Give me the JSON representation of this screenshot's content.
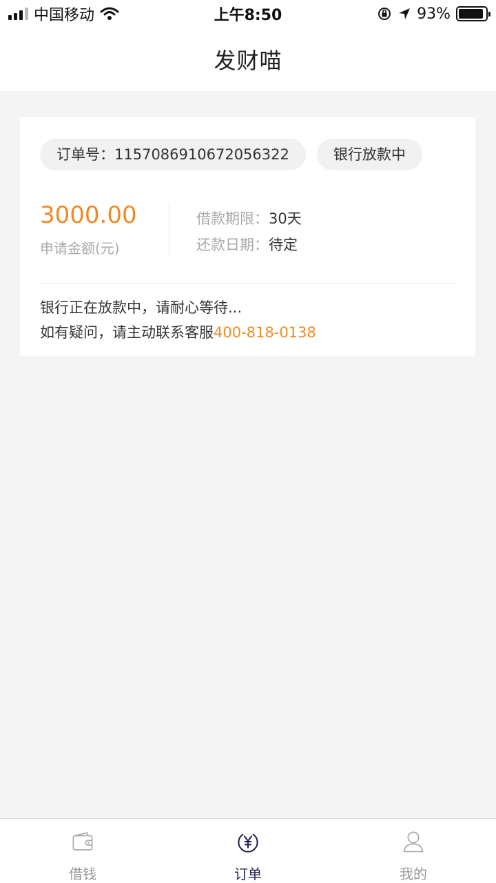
{
  "status_bar": {
    "carrier": "中国移动",
    "time": "上午8:50",
    "battery": "93%",
    "battery_level": 0.93
  },
  "nav": {
    "title": "发财喵"
  },
  "order": {
    "order_no_label": "订单号：",
    "order_no": "1157086910672056322",
    "status": "银行放款中",
    "amount": "3000.00",
    "amount_label": "申请金额(元)",
    "term_label": "借款期限：",
    "term_value": "30天",
    "repay_label": "还款日期：",
    "repay_value": "待定",
    "message_line1": "银行正在放款中，请耐心等待...",
    "message_line2": "如有疑问，请主动联系客服",
    "phone": "400-818-0138"
  },
  "tabs": [
    {
      "label": "借钱",
      "icon": "wallet-icon",
      "active": false
    },
    {
      "label": "订单",
      "icon": "yen-icon",
      "active": true
    },
    {
      "label": "我的",
      "icon": "user-icon",
      "active": false
    }
  ],
  "colors": {
    "accent": "#f08a24",
    "active_tab": "#262652",
    "inactive_tab": "#999999"
  }
}
